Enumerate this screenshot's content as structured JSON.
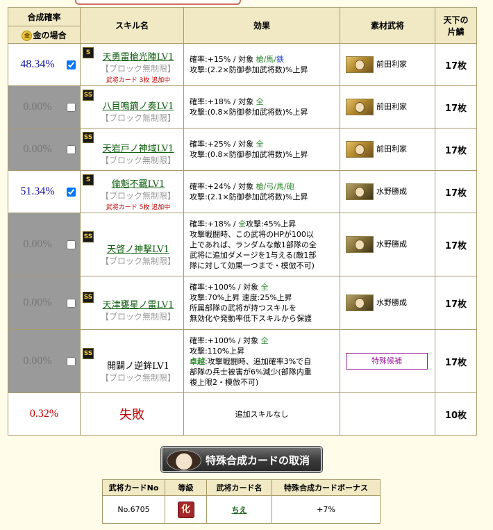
{
  "header": {
    "rate": "合成確率",
    "gold_coin": "金",
    "gold": "金の場合",
    "skill": "スキル名",
    "effect": "効果",
    "material": "素材武将",
    "count_line1": "天下の",
    "count_line2": "片鱗"
  },
  "rows": [
    {
      "rate": "48.34%",
      "checked": true,
      "active": true,
      "badge": "S",
      "name": "天勇雷槍光陣LV1",
      "block": "【ブロック無制限】",
      "card": "武将カード 3枚 追加中",
      "eff": [
        "確率:+15% / 対象 ",
        "槍/馬/",
        "鉄",
        "攻撃:(2.2×防御参加武将数)%上昇"
      ],
      "mat": "前田利家",
      "count": "17枚"
    },
    {
      "rate": "0.00%",
      "checked": false,
      "active": false,
      "badge": "SS",
      "name": "八目鳴鏑ノ奏LV1",
      "block": "【ブロック無制限】",
      "eff": [
        "確率:+18% / 対象 ",
        "全",
        "攻撃:(0.8×防御参加武将数)%上昇"
      ],
      "mat": "前田利家",
      "count": "17枚"
    },
    {
      "rate": "0.00%",
      "checked": false,
      "active": false,
      "badge": "SS",
      "name": "天岩戸ノ神域LV1",
      "block": "【ブロック無制限】",
      "eff": [
        "確率:+25% / 対象 ",
        "全",
        "攻撃:(0.8×防御参加武将数)%上昇"
      ],
      "mat": "前田利家",
      "count": "17枚"
    },
    {
      "rate": "51.34%",
      "checked": true,
      "active": true,
      "badge": "S",
      "name": "倫魁不羈LV1",
      "block": "【ブロック無制限】",
      "card": "武将カード 5枚 追加中",
      "eff": [
        "確率:+24% / 対象 ",
        "槍/弓/馬/砲",
        "攻撃:(2.1×防御参加武将数)%上昇"
      ],
      "mat": "水野勝成",
      "count": "17枚"
    },
    {
      "rate": "0.00%",
      "checked": false,
      "active": false,
      "badge": "SS",
      "name": "天啓ノ神撃LV1",
      "block": "【ブロック無制限】",
      "eff": [
        "確率:+18% / ",
        "全",
        "攻撃:45%上昇",
        "攻撃戦闘時、この武将のHPが100以",
        "上であれば、ランダムな敵1部隊の全",
        "武将に追加ダメージを1与える(敵1部",
        "隊に対して効果一つまで・模倣不可)"
      ],
      "mat": "水野勝成",
      "count": "17枚"
    },
    {
      "rate": "0.00%",
      "checked": false,
      "active": false,
      "badge": "SS",
      "name": "天津甕星ノ雷LV1",
      "block": "【ブロック無制限】",
      "eff": [
        "確率:+100% / 対象 ",
        "全",
        "攻撃:70%上昇 速度:25%上昇",
        "所属部隊の武将が持つスキルを",
        "無効化や発動率低下スキルから保護"
      ],
      "mat": "水野勝成",
      "count": "17枚"
    },
    {
      "rate": "0.00%",
      "checked": false,
      "active": false,
      "badge": "SS",
      "name": "開闢ノ逆鉾LV1",
      "block": "【ブロック無制限】",
      "eff": [
        "確率:+100% / 対象 ",
        "全",
        "攻撃:110%上昇",
        "卓越",
        ":攻撃戦闘時、追加確率3%で自",
        "部隊の兵士被害が6%減少(部隊内重",
        "複上限2・模倣不可)"
      ],
      "mat_special": "特殊候補",
      "count": "17枚"
    }
  ],
  "fail": {
    "rate": "0.32%",
    "text": "失敗",
    "note": "追加スキルなし",
    "count": "10枚"
  },
  "cancel_button": "特殊合成カードの取消",
  "card_table": {
    "headers": [
      "武将カードNo",
      "等級",
      "武将カード名",
      "特殊合成カードボーナス"
    ],
    "no": "No.6705",
    "rank": "化",
    "name": "ちえ",
    "bonus": "+7%"
  },
  "colors": {
    "active_rate": "#1010a0",
    "inactive_bg": "#9a9a9a",
    "fail": "#c00000",
    "skill_link": "#106010"
  }
}
